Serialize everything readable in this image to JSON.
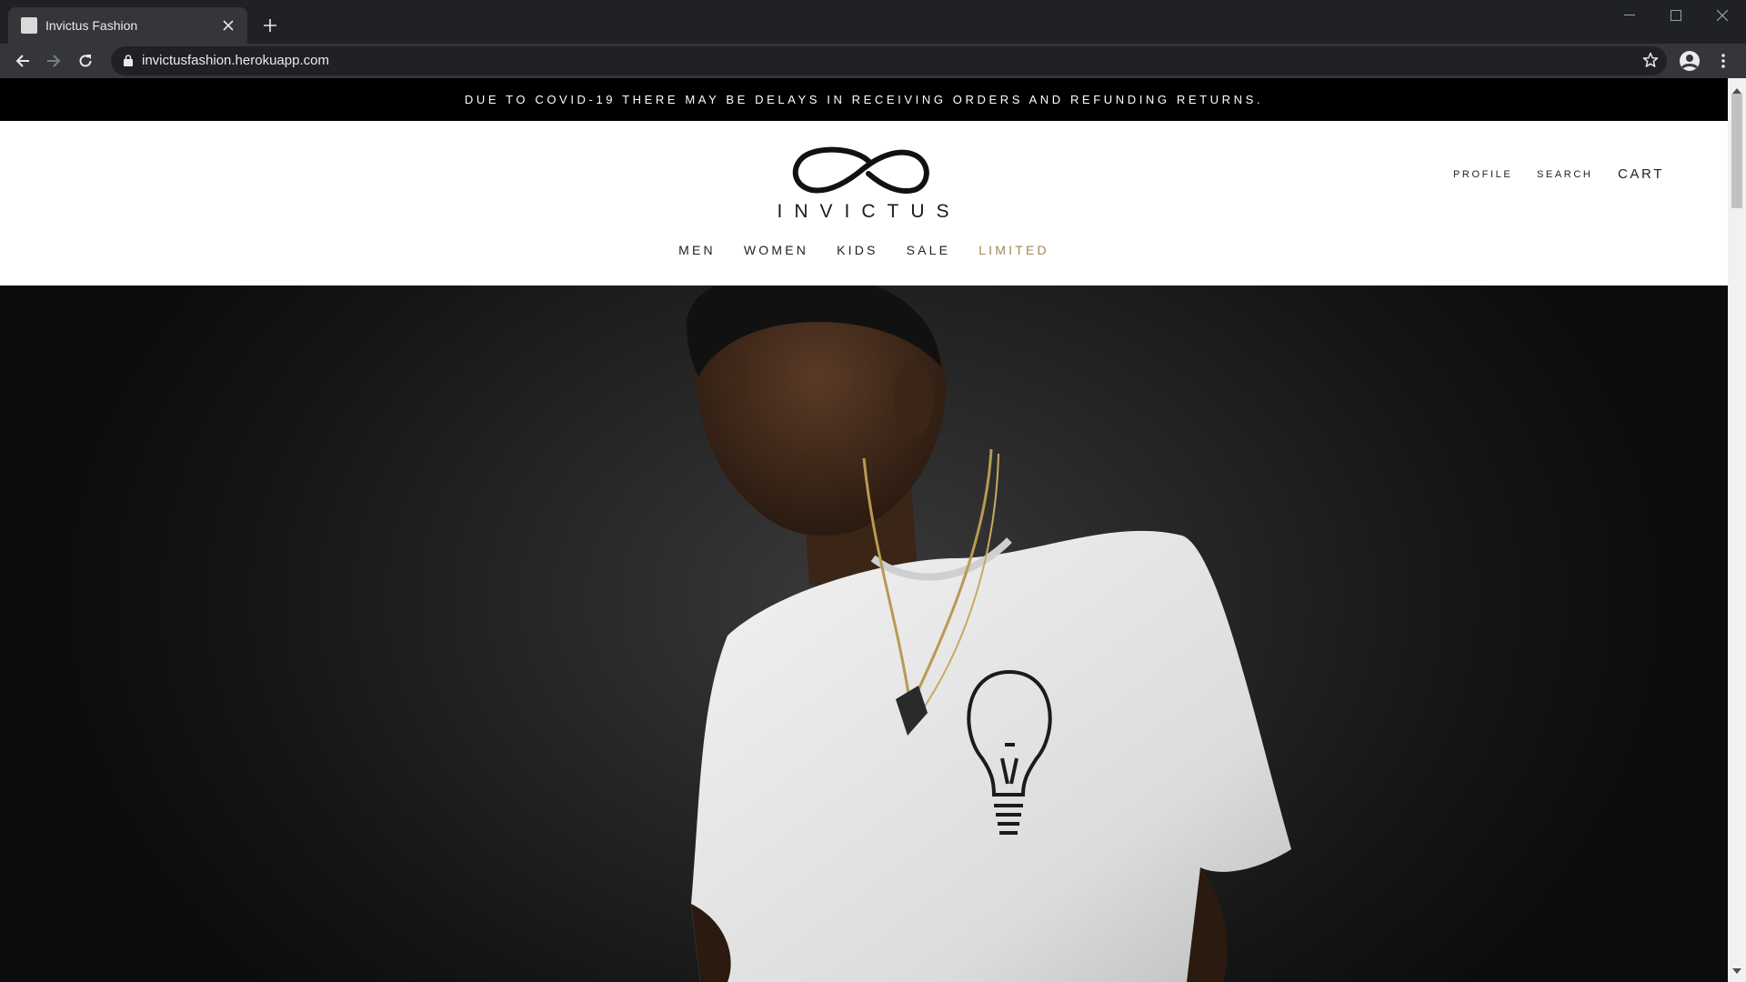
{
  "browser": {
    "tab_title": "Invictus Fashion",
    "url": "invictusfashion.herokuapp.com"
  },
  "site": {
    "announcement": "DUE TO COVID-19 THERE MAY BE DELAYS IN RECEIVING ORDERS AND REFUNDING RETURNS.",
    "logo_text": "INVICTUS",
    "nav": {
      "men": "MEN",
      "women": "WOMEN",
      "kids": "KIDS",
      "sale": "SALE",
      "limited": "LIMITED"
    },
    "account": {
      "profile": "PROFILE",
      "search": "SEARCH",
      "cart": "CART"
    },
    "colors": {
      "accent_limited": "#a3865a",
      "announcement_bg": "#000000"
    }
  },
  "hero": {
    "description_icon": "hero-photo"
  }
}
